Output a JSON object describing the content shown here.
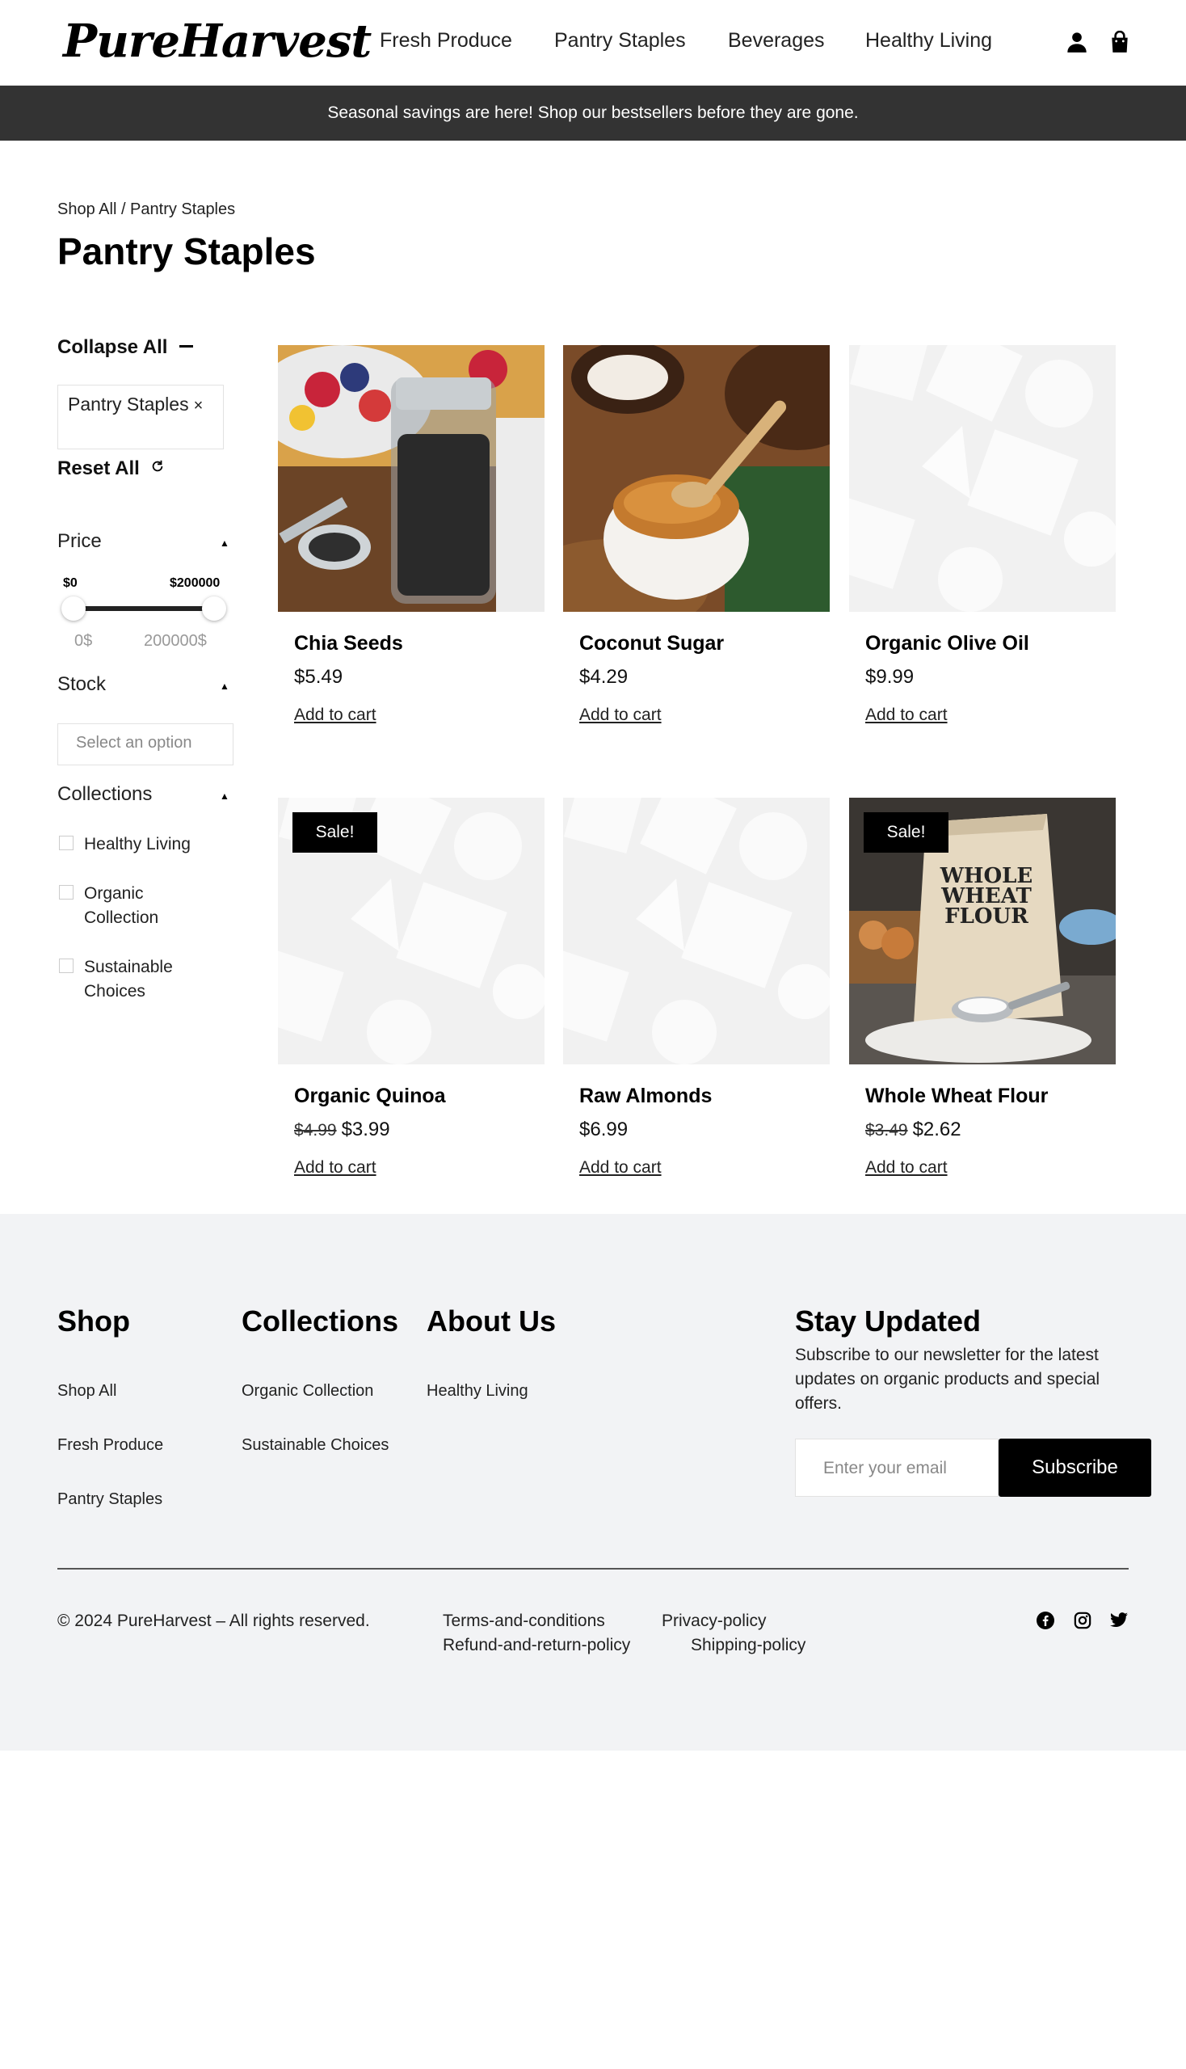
{
  "brand": {
    "logo_text": "PureHarvest"
  },
  "nav": {
    "items": [
      "Fresh Produce",
      "Pantry Staples",
      "Beverages",
      "Healthy Living"
    ],
    "account_icon": "user-icon",
    "cart_icon": "shopping-bag-icon"
  },
  "announcement": "Seasonal savings are here! Shop our bestsellers before they are gone.",
  "breadcrumb": "Shop All / Pantry Staples",
  "page_title": "Pantry Staples",
  "filters": {
    "collapse_all": "Collapse All",
    "active_tag": "Pantry Staples",
    "active_tag_remove": "×",
    "reset_all": "Reset All",
    "price": {
      "label": "Price",
      "min_label": "$0",
      "max_label": "$200000",
      "min_value": "0$",
      "max_value": "200000$",
      "range_fraction": [
        0,
        1
      ]
    },
    "stock": {
      "label": "Stock",
      "placeholder": "Select an option"
    },
    "collections": {
      "label": "Collections",
      "options": [
        "Healthy Living",
        "Organic Collection",
        "Sustainable Choices"
      ]
    }
  },
  "products": [
    {
      "name": "Chia Seeds",
      "price": "$5.49",
      "old_price": "",
      "sale": false,
      "cta": "Add to cart"
    },
    {
      "name": "Coconut Sugar",
      "price": "$4.29",
      "old_price": "",
      "sale": false,
      "cta": "Add to cart"
    },
    {
      "name": "Organic Olive Oil",
      "price": "$9.99",
      "old_price": "",
      "sale": false,
      "cta": "Add to cart"
    },
    {
      "name": "Organic Quinoa",
      "price": "$3.99",
      "old_price": "$4.99",
      "sale": true,
      "cta": "Add to cart"
    },
    {
      "name": "Raw Almonds",
      "price": "$6.99",
      "old_price": "",
      "sale": false,
      "cta": "Add to cart"
    },
    {
      "name": "Whole Wheat Flour",
      "price": "$2.62",
      "old_price": "$3.49",
      "sale": true,
      "cta": "Add to cart"
    }
  ],
  "sale_badge": "Sale!",
  "flour_bag_text": [
    "WHOLE",
    "WHEAT",
    "FLOUR"
  ],
  "footer": {
    "shop": {
      "heading": "Shop",
      "links": [
        "Shop All",
        "Fresh Produce",
        "Pantry Staples"
      ]
    },
    "collections": {
      "heading": "Collections",
      "links": [
        "Organic Collection",
        "Sustainable Choices"
      ]
    },
    "about": {
      "heading": "About Us",
      "links": [
        "Healthy Living"
      ]
    },
    "newsletter": {
      "heading": "Stay Updated",
      "text": "Subscribe to our newsletter for the latest updates on organic products and special offers.",
      "placeholder": "Enter your email",
      "button": "Subscribe"
    },
    "copyright": "© 2024 PureHarvest – All rights reserved.",
    "legal_links": [
      "Terms-and-conditions",
      "Privacy-policy",
      "Refund-and-return-policy",
      "Shipping-policy"
    ],
    "social_icons": [
      "facebook-icon",
      "instagram-icon",
      "twitter-icon"
    ]
  },
  "colors": {
    "announcement_bg": "#333333",
    "footer_bg": "#f2f3f5",
    "badge_bg": "#000000",
    "button_bg": "#000000"
  }
}
